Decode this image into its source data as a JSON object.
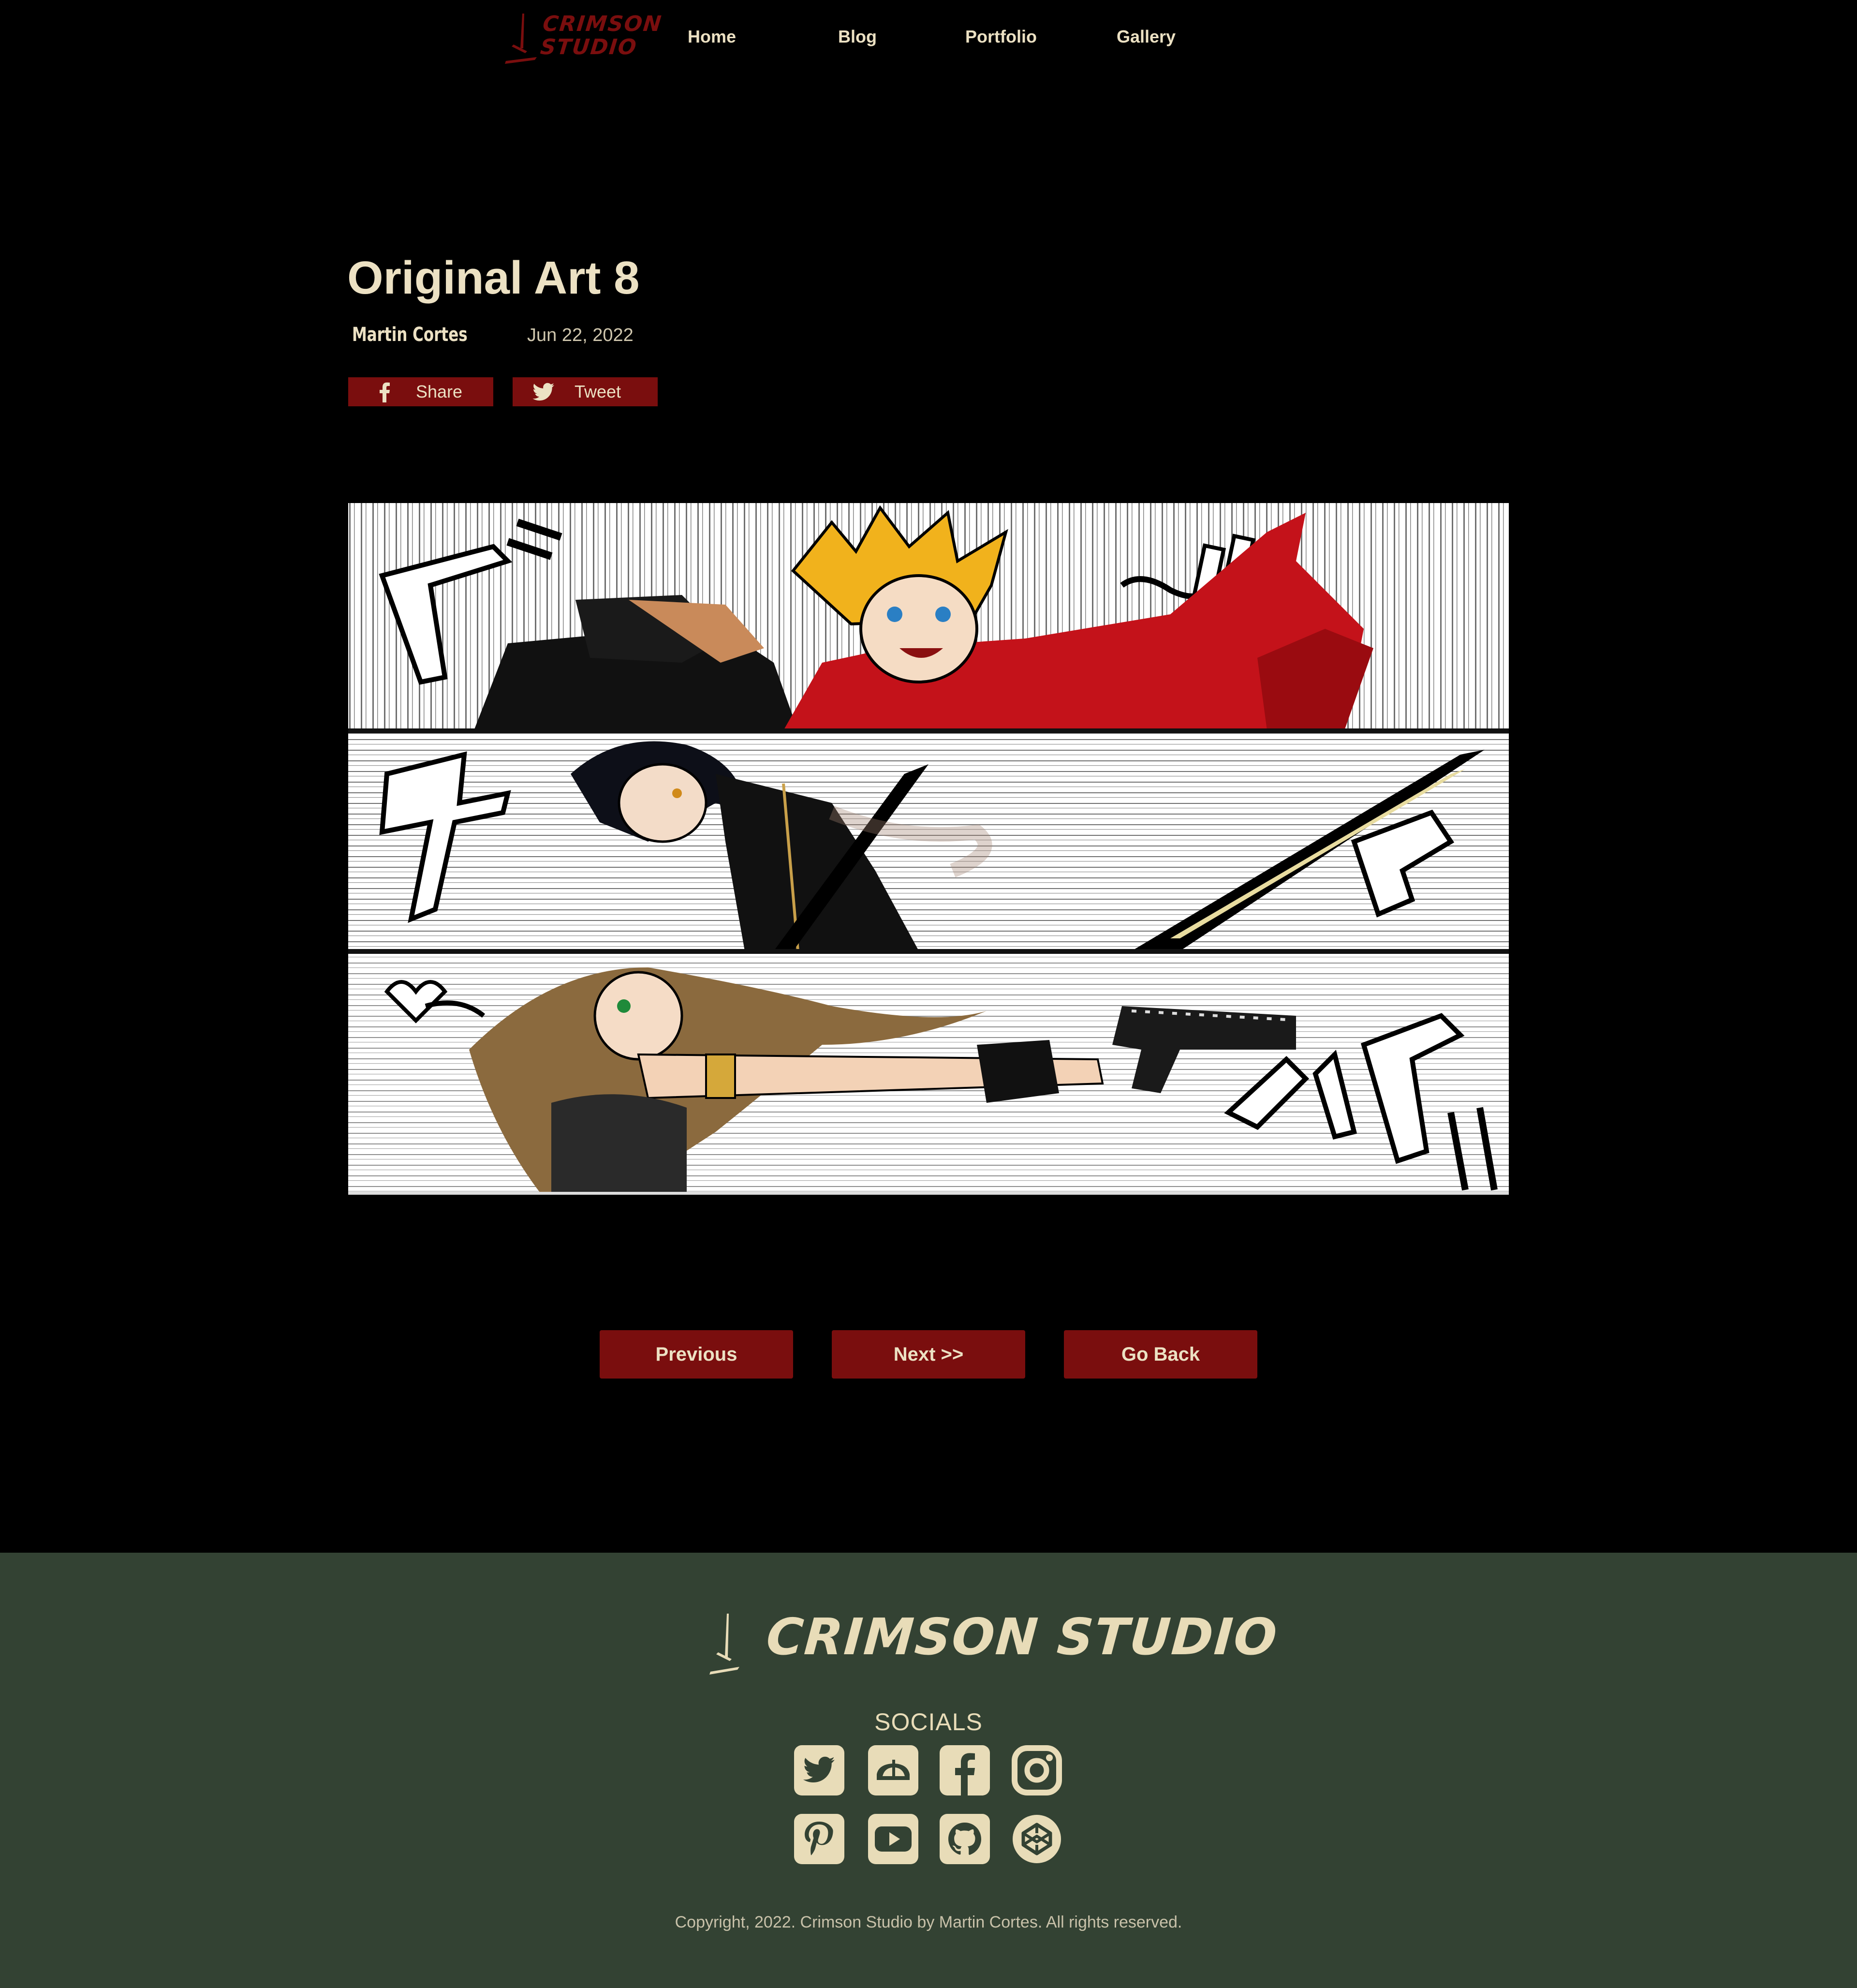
{
  "brand": {
    "logo_line1": "CRIMSON",
    "logo_line2": "STUDIO",
    "footer_name": "CRIMSON STUDIO",
    "accent_color": "#7a0e0e",
    "footer_bg": "#334233",
    "text_color": "#ece1c3"
  },
  "nav": {
    "home": "Home",
    "blog": "Blog",
    "portfolio": "Portfolio",
    "gallery": "Gallery"
  },
  "post": {
    "title": "Original Art 8",
    "author": "Martin Cortes",
    "date": "Jun 22, 2022",
    "share_label": "Share",
    "tweet_label": "Tweet"
  },
  "pager": {
    "previous": "Previous",
    "next": "Next >>",
    "back": "Go Back"
  },
  "footer": {
    "socials_title": "SOCIALS",
    "social_icons": [
      "twitter-icon",
      "deviantart-icon",
      "facebook-icon",
      "instagram-icon",
      "pinterest-icon",
      "youtube-icon",
      "github-icon",
      "codepen-icon"
    ],
    "copyright": "Copyright, 2022. Crimson Studio by Martin Cortes. All rights reserved."
  }
}
